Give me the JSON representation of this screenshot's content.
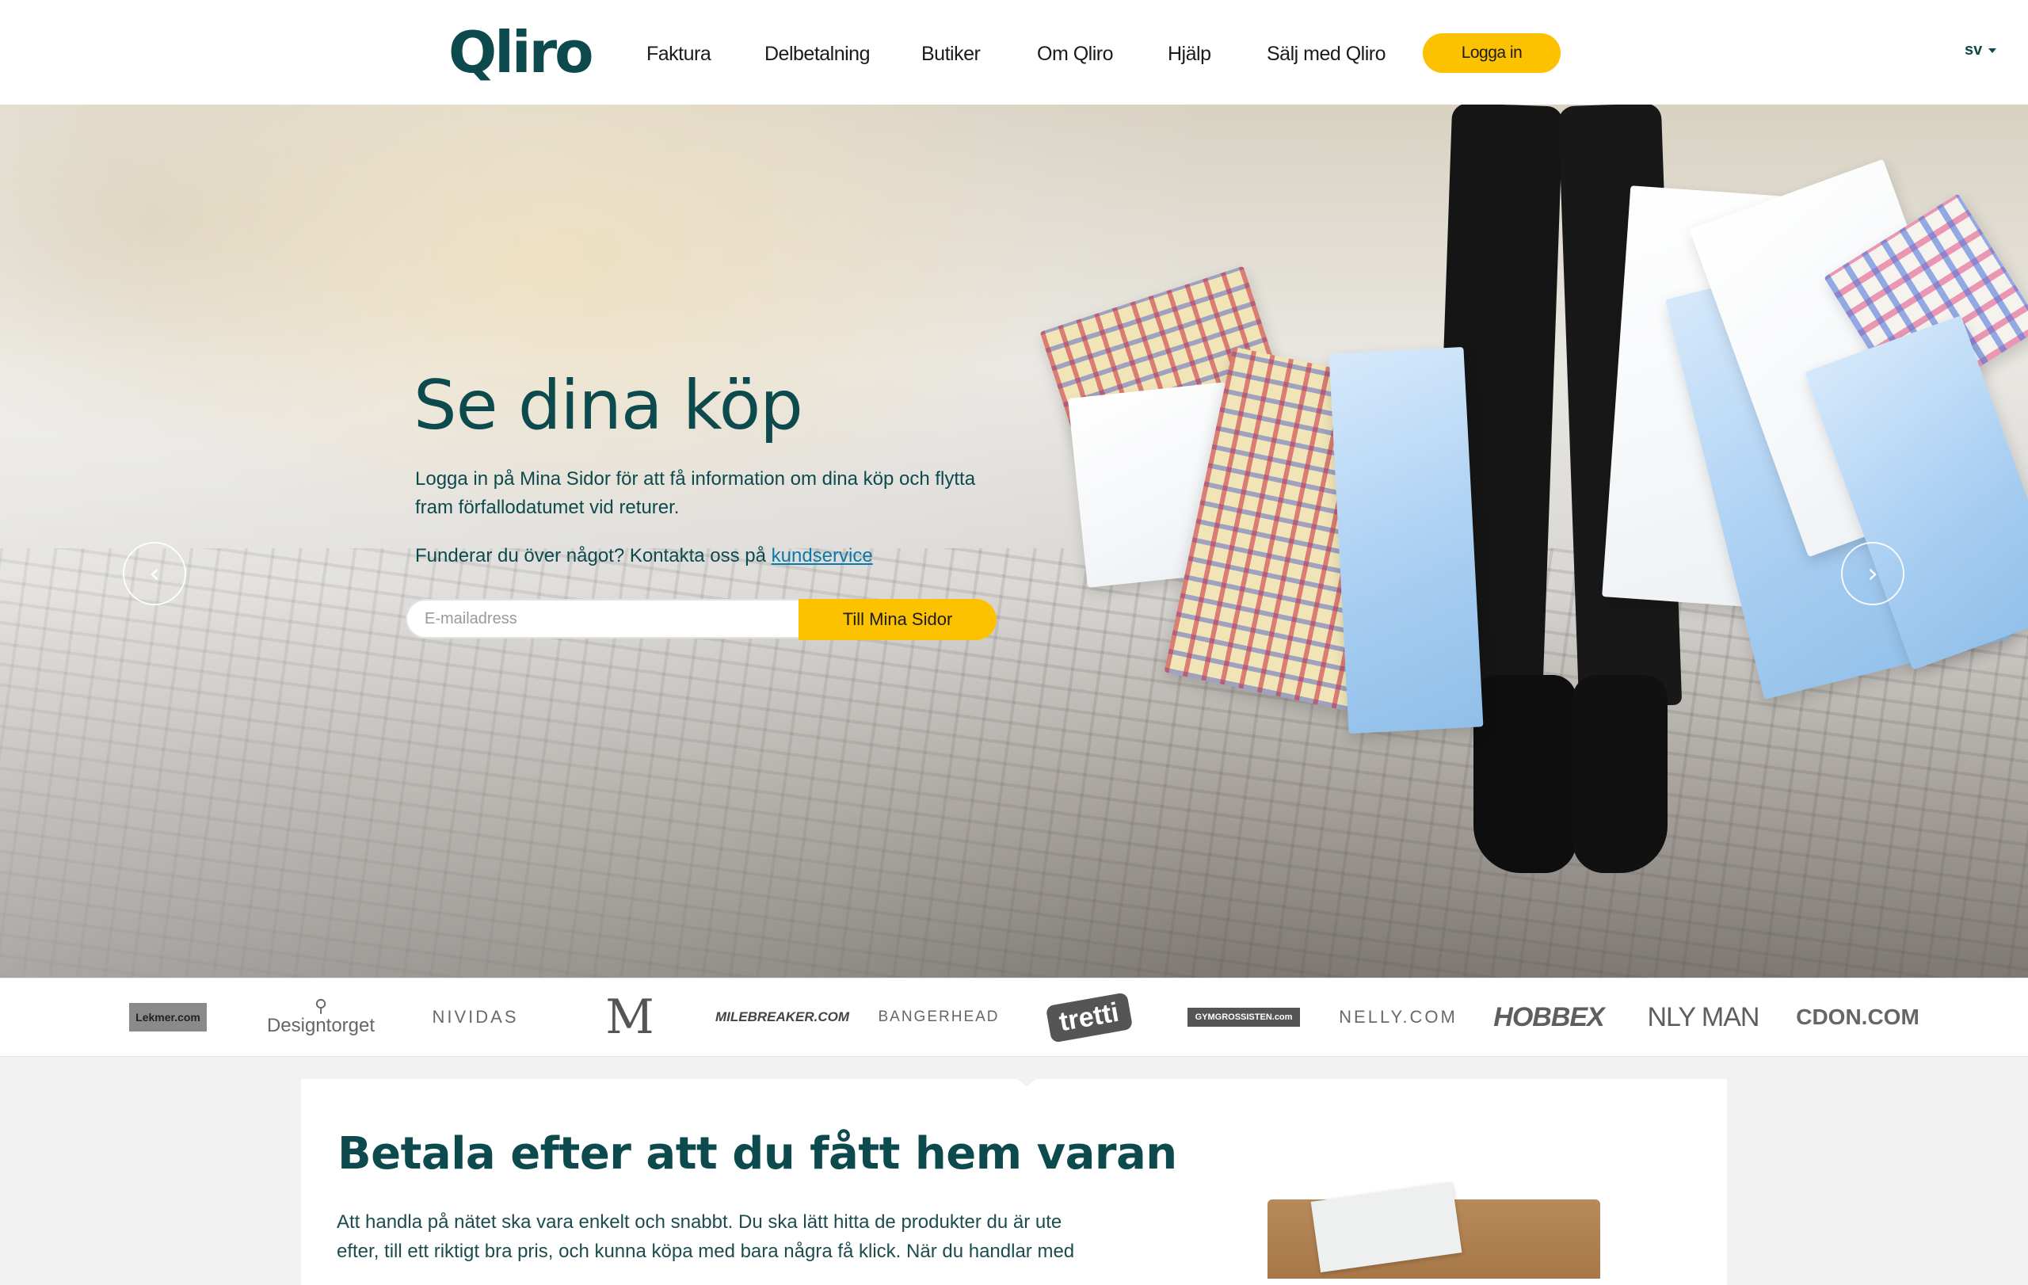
{
  "header": {
    "logo": "Qliro",
    "nav": [
      "Faktura",
      "Delbetalning",
      "Butiker",
      "Om Qliro",
      "Hjälp",
      "Sälj med Qliro"
    ],
    "login_label": "Logga in",
    "language": "sv"
  },
  "hero": {
    "title": "Se dina köp",
    "text": "Logga in på Mina Sidor för att få information om dina köp och flytta fram förfallodatumet vid returer.",
    "contact_prefix": "Funderar du över något? Kontakta oss på",
    "contact_link": "kundservice",
    "email_placeholder": "E-mailadress",
    "submit_label": "Till Mina Sidor",
    "prev_arrow": "‹",
    "next_arrow": "›"
  },
  "brands": [
    "Lekmer.com",
    "Designtorget",
    "NIVIDAS",
    "M",
    "MILEBREAKER.COM",
    "BANGERHEAD",
    "tretti",
    "GYMGROSSISTEN.com",
    "NELLY.COM",
    "HOBBEX",
    "NLY MAN",
    "CDON.COM"
  ],
  "content": {
    "title": "Betala efter att du fått hem varan",
    "text": "Att handla på nätet ska vara enkelt och snabbt. Du ska lätt hitta de produkter du är ute efter, till ett riktigt bra pris, och kunna köpa med bara några få klick. När du handlar med"
  }
}
